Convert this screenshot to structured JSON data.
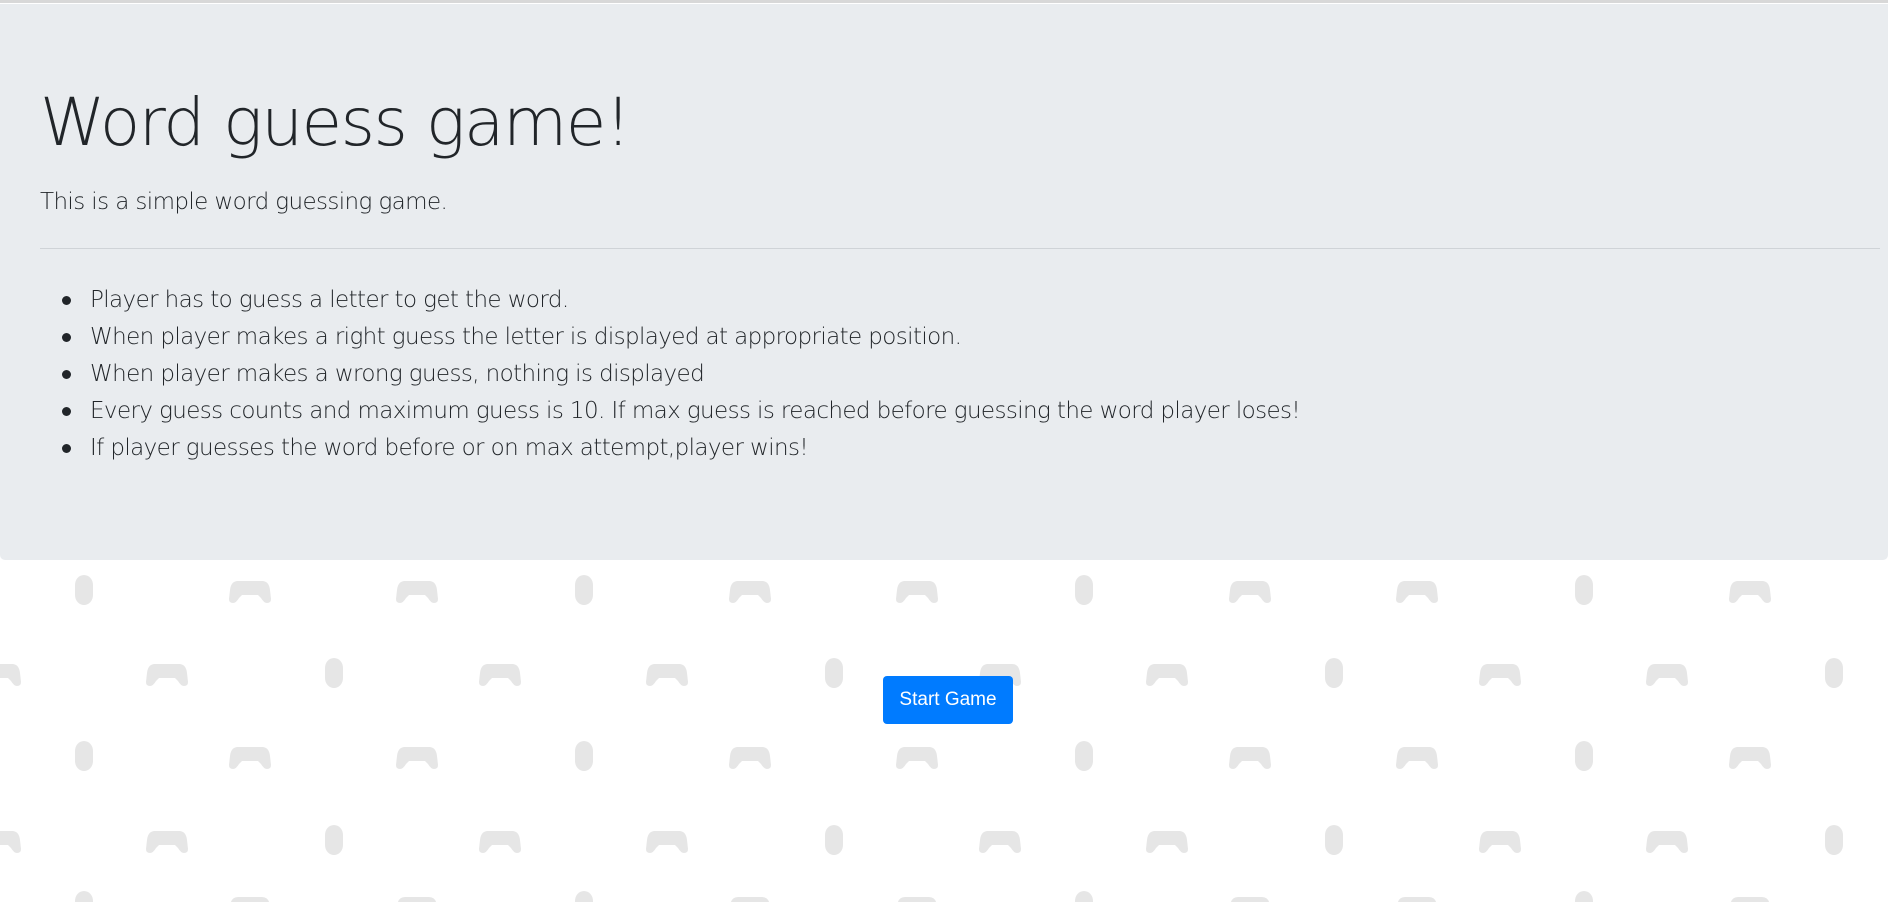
{
  "page": {
    "title": "Word guess game!",
    "subtitle": "This is a simple word guessing game."
  },
  "rules": [
    "Player has to guess a letter to get the word.",
    "When player makes a right guess the letter is displayed at appropriate position.",
    "When player makes a wrong guess, nothing is displayed",
    "Every guess counts and maximum guess is 10. If max guess is reached before guessing the word player loses!",
    "If player guesses the word before or on max attempt,player wins!"
  ],
  "actions": {
    "start_label": "Start Game"
  },
  "background": {
    "pattern_icons": [
      "gamepad-icon",
      "mouse-icon"
    ],
    "pattern_color": "#e6e6e6"
  },
  "colors": {
    "jumbotron": "#e9ecef",
    "primary": "#007bff",
    "text": "#212529"
  }
}
